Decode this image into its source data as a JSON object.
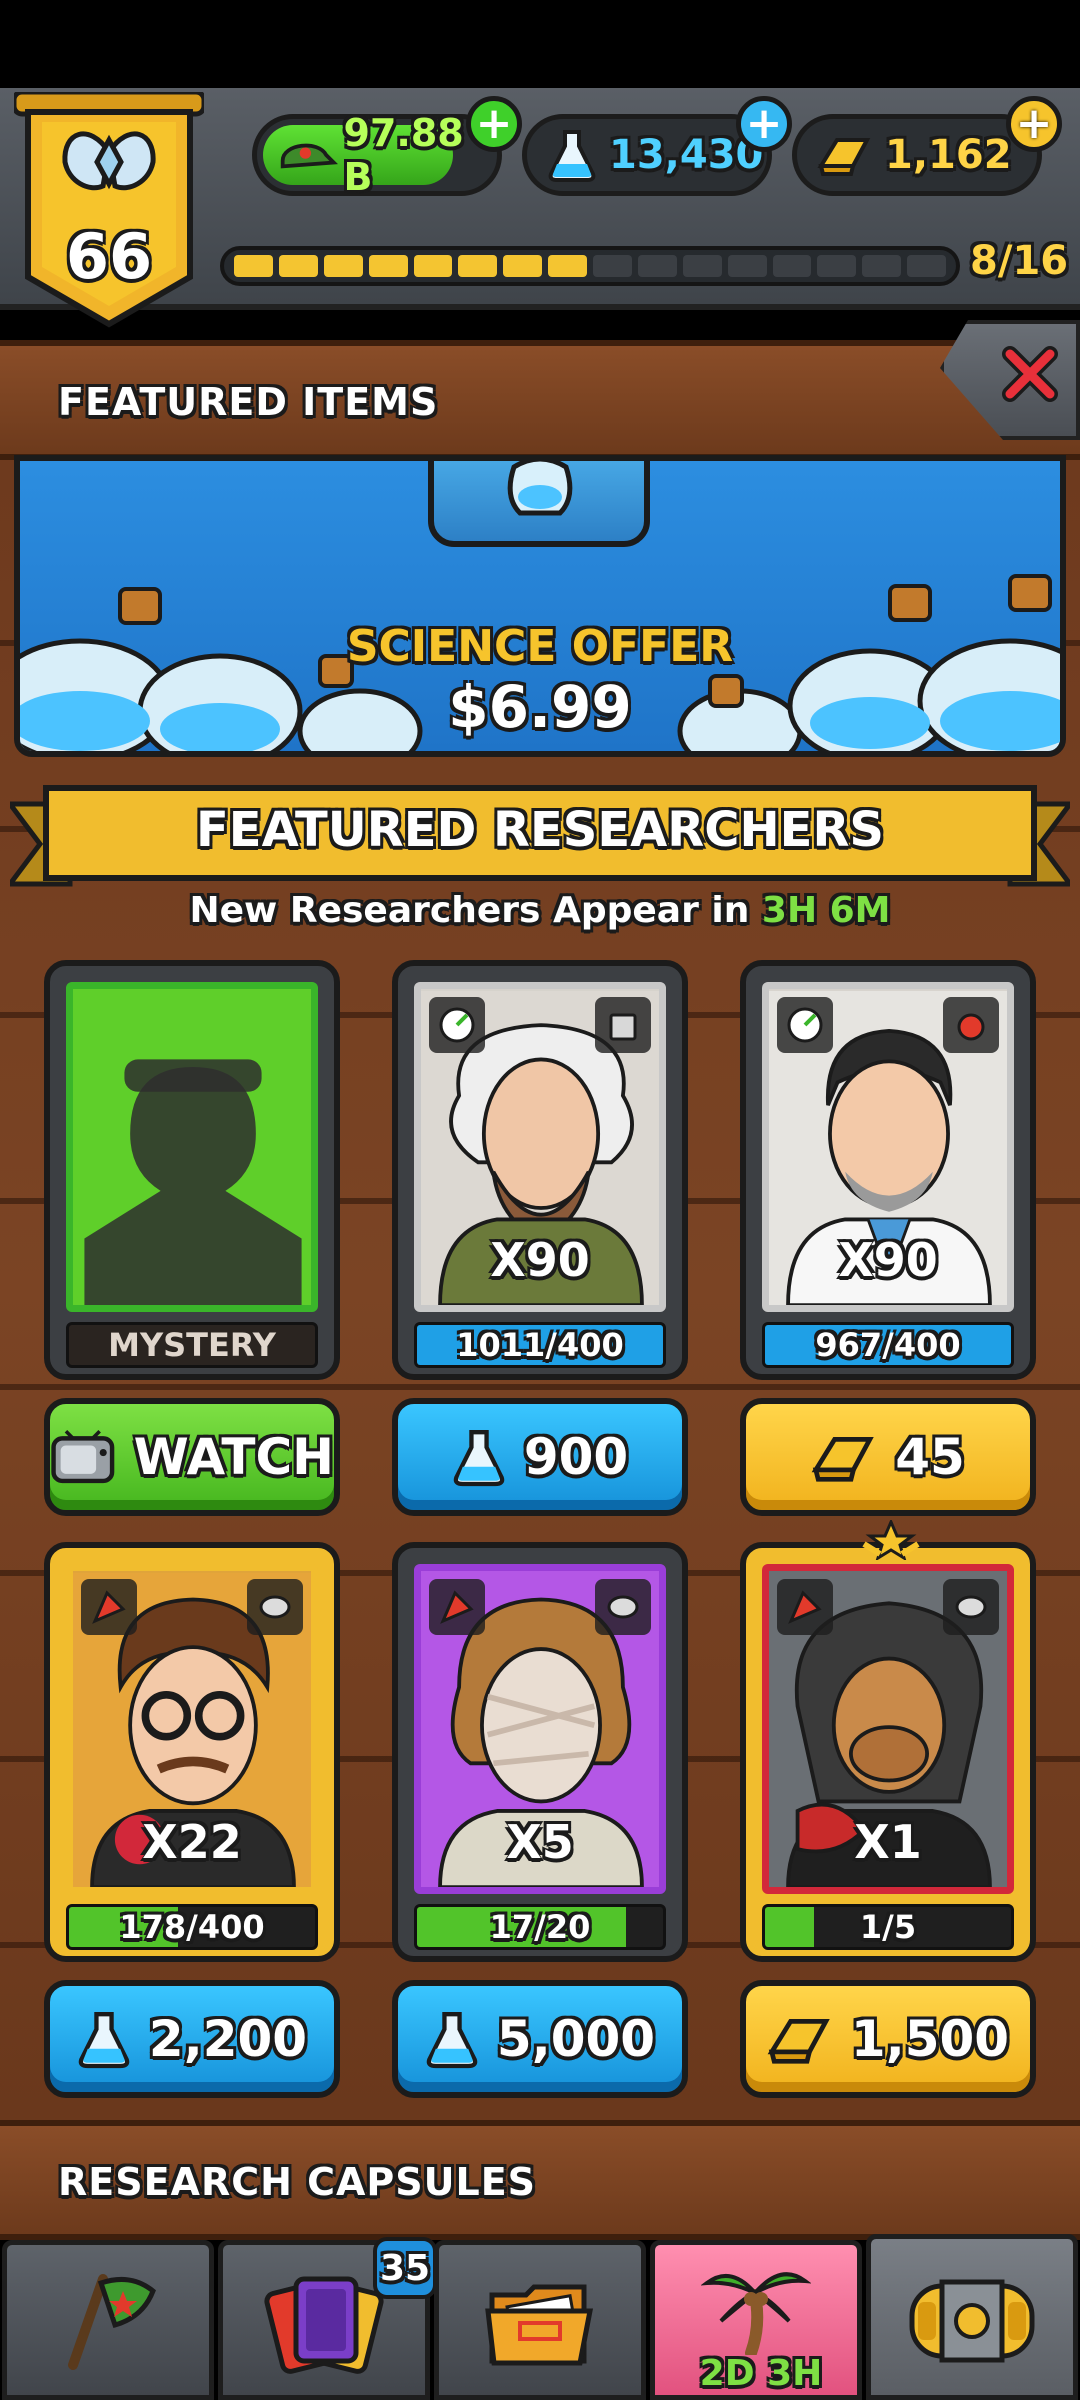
{
  "status_bar": {},
  "player": {
    "level": "66"
  },
  "resources": {
    "cash": "97.88 B",
    "science": "13,430",
    "gold": "1,162"
  },
  "xp": {
    "label": "8/16",
    "filled": 8,
    "total": 16
  },
  "featured_items": {
    "title": "FEATURED ITEMS",
    "offer": {
      "title": "SCIENCE OFFER",
      "price": "$6.99"
    }
  },
  "featured_researchers": {
    "title": "FEATURED RESEARCHERS",
    "subtitle_prefix": "New Researchers Appear in",
    "subtitle_time": "3H 6M",
    "cards": [
      {
        "name": "MYSTERY",
        "count": "",
        "progress_label": "MYSTERY",
        "progress": 0,
        "button_label": "WATCH",
        "button_type": "watch",
        "frame": "green"
      },
      {
        "name": "Bearded scientist",
        "count": "X90",
        "progress_label": "1011/400",
        "progress": 1,
        "button_label": "900",
        "button_type": "science",
        "frame": "gray"
      },
      {
        "name": "Doctor",
        "count": "X90",
        "progress_label": "967/400",
        "progress": 1,
        "button_label": "45",
        "button_type": "gold",
        "frame": "gray"
      },
      {
        "name": "Hipster",
        "count": "X22",
        "progress_label": "178/400",
        "progress": 0.445,
        "button_label": "2,200",
        "button_type": "science",
        "frame": "gold"
      },
      {
        "name": "Mummy nurse",
        "count": "X5",
        "progress_label": "17/20",
        "progress": 0.85,
        "button_label": "5,000",
        "button_type": "science",
        "frame": "purple"
      },
      {
        "name": "Alien rocker",
        "count": "X1",
        "progress_label": "1/5",
        "progress": 0.2,
        "button_label": "1,500",
        "button_type": "gold",
        "frame": "red"
      }
    ]
  },
  "research_capsules": {
    "title": "RESEARCH CAPSULES"
  },
  "bottom_nav": {
    "cards_badge": "35",
    "event_timer": "2D 3H"
  },
  "colors": {
    "cash_green": "#4fd12a",
    "science_blue": "#36c3ff",
    "gold_yellow": "#f6c42c",
    "timer_green": "#7ee044"
  }
}
